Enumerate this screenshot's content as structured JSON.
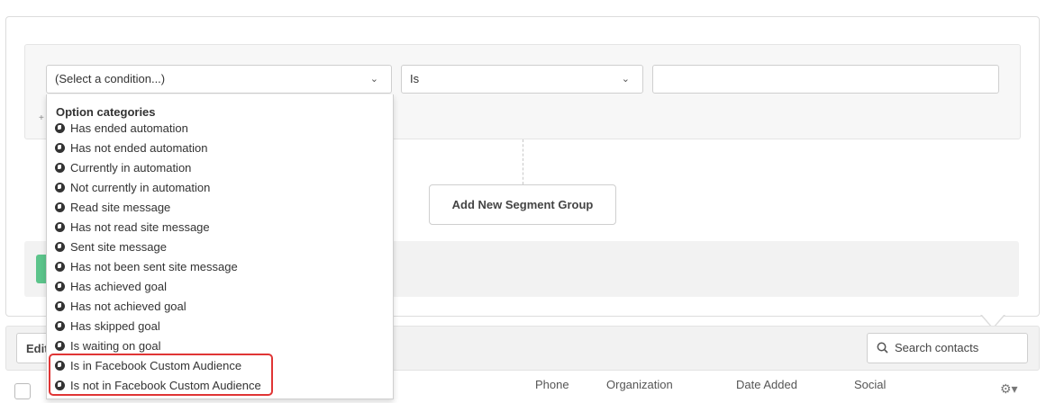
{
  "condition_select": {
    "value": "(Select a condition...)"
  },
  "operator_select": {
    "value": "Is"
  },
  "value_input": {
    "value": ""
  },
  "add_group_label": "Add New Segment Group",
  "dropdown": {
    "heading": "Option categories",
    "items": [
      "Has ended automation",
      "Has not ended automation",
      "Currently in automation",
      "Not currently in automation",
      "Read site message",
      "Has not read site message",
      "Sent site message",
      "Has not been sent site message",
      "Has achieved goal",
      "Has not achieved goal",
      "Has skipped goal",
      "Is waiting on goal",
      "Is in Facebook Custom Audience",
      "Is not in Facebook Custom Audience"
    ]
  },
  "toolbar": {
    "edit_label": "Edit",
    "search_placeholder": "Search contacts"
  },
  "table": {
    "columns": [
      "Phone",
      "Organization",
      "Date Added",
      "Social"
    ]
  },
  "colors": {
    "highlight": "#e03535",
    "green": "#5cc48b"
  }
}
